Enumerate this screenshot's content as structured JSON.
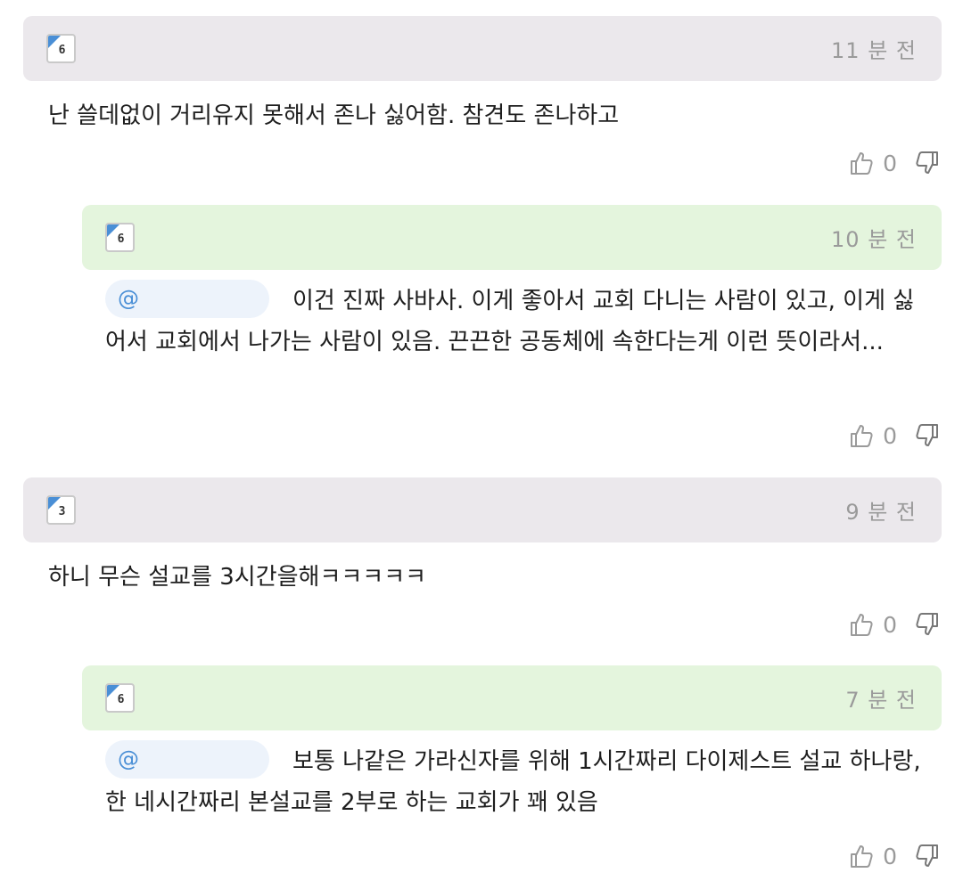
{
  "comments": [
    {
      "level": "6",
      "time": "11 분 전",
      "mention": "",
      "text": "난 쓸데없이 거리유지 못해서 존나 싫어함. 참견도 존나하고",
      "likes": "0"
    },
    {
      "level": "6",
      "time": "10 분 전",
      "mention": "@",
      "text": "이건 진짜 사바사. 이게 좋아서 교회 다니는 사람이 있고, 이게 싫어서 교회에서 나가는 사람이 있음. 끈끈한 공동체에 속한다는게 이런 뜻이라서...",
      "likes": "0"
    },
    {
      "level": "3",
      "time": "9 분 전",
      "mention": "",
      "text": "하니 무슨 설교를 3시간을해ㅋㅋㅋㅋㅋ",
      "likes": "0"
    },
    {
      "level": "6",
      "time": "7 분 전",
      "mention": "@",
      "text": "보통 나같은 가라신자를 위해 1시간짜리 다이제스트 설교 하나랑, 한 네시간짜리 본설교를 2부로 하는 교회가 꽤 있음",
      "likes": "0"
    }
  ],
  "icons": {
    "like": "thumbs-up-icon",
    "dislike": "thumbs-down-icon"
  },
  "colors": {
    "top_header": "#ebe8ec",
    "reply_header": "#e4f5dd",
    "mention_bg": "#edf3fb",
    "accent": "#4a8fd6",
    "muted": "#9a9a9a"
  }
}
